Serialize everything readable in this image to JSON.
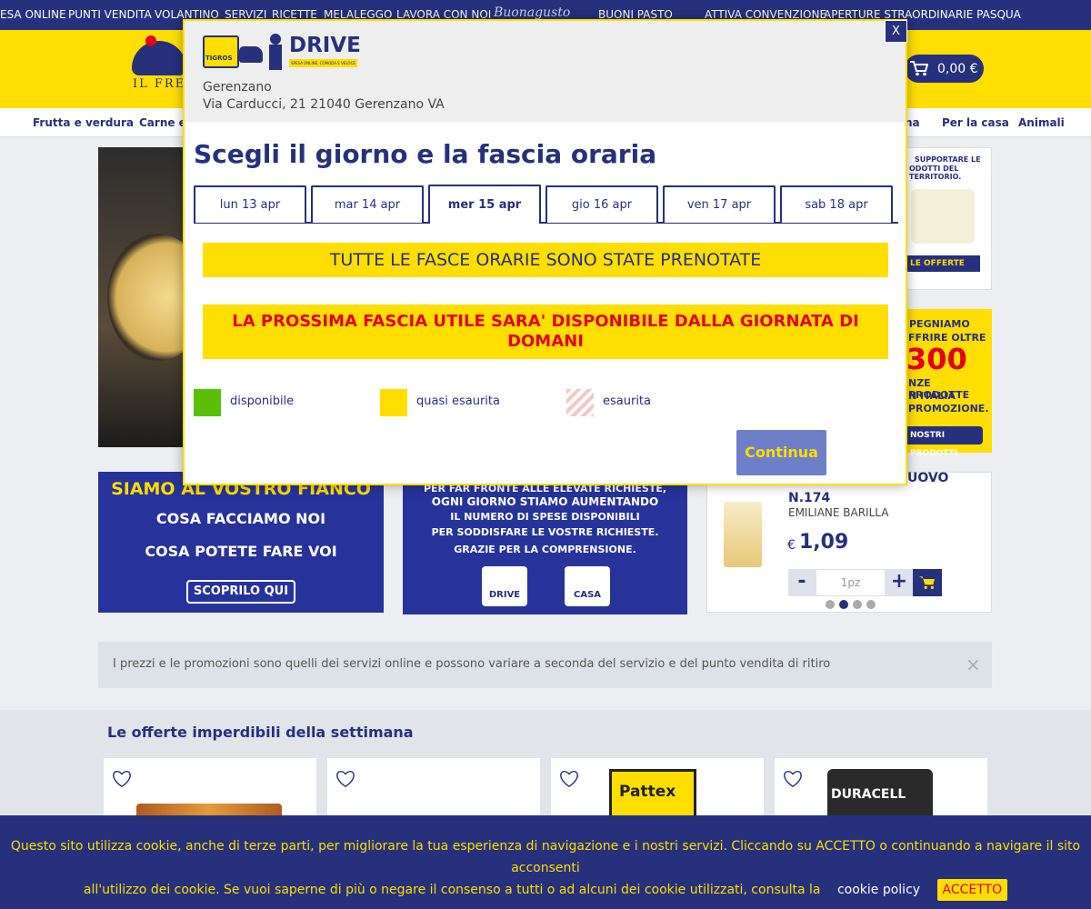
{
  "topbar": {
    "items": [
      "ESA ONLINE",
      "PUNTI VENDITA",
      "VOLANTINO",
      "SERVIZI",
      "RICETTE",
      "MELALEGGO",
      "LAVORA CON NOI",
      "Buonagusto",
      "BUONI PASTO",
      "ATTIVA CONVENZIONE",
      "APERTURE STRAORDINARIE PASQUA"
    ]
  },
  "header": {
    "logo_tagline": "IL FRES",
    "cart_total": "0,00 €"
  },
  "catnav": {
    "items": [
      "Frutta e verdura",
      "Carne e",
      "na",
      "Per la casa",
      "Animali"
    ]
  },
  "banners": {
    "rb1_line1": "SUPPORTARE LE",
    "rb1_line2": "ODOTTI DEL TERRITORIO.",
    "rb1_btn": "LE OFFERTE",
    "rb2_line1": "PEGNIAMO",
    "rb2_line2": "FFRIRE OLTRE",
    "rb2_num": "300",
    "rb2_line3": "NZE PRODOTTE",
    "rb2_line4": "N ITALIA",
    "rb2_line5": "PROMOZIONE.",
    "rb2_btn": "NOSTRI PRODOTTI",
    "siamo_title": "SIAMO AL VOSTRO FIANCO",
    "siamo_l1": "COSA FACCIAMO NOI",
    "siamo_l2": "COSA POTETE FARE VOI",
    "siamo_btn": "SCOPRILO QUI",
    "drive_l1": "PER FAR FRONTE ALLE ELEVATE RICHIESTE,",
    "drive_l2": "OGNI GIORNO STIAMO AUMENTANDO",
    "drive_l3": "IL NUMERO DI SPESE DISPONIBILI",
    "drive_l4": "PER SODDISFARE LE VOSTRE RICHIESTE.",
    "drive_l5": "GRAZIE PER LA COMPRENSIONE.",
    "drive_b1": "DRIVE",
    "drive_b2": "CASA"
  },
  "product": {
    "title_tail": "UOVO",
    "code": "N.174",
    "name": "EMILIANE BARILLA",
    "currency": "€",
    "price": "1,09",
    "qty": "1pz",
    "minus": "-",
    "plus": "+"
  },
  "notice": {
    "text": "I prezzi e le promozioni sono quelli dei servizi online e possono variare a seconda del servizio e del punto vendita di ritiro",
    "close": "×"
  },
  "offerte": {
    "title": "Le offerte imperdibili della settimana",
    "card3_brand": "Pattex",
    "card4_brand": "DURACELL"
  },
  "cookie": {
    "text1": "Questo sito utilizza cookie, anche di terze parti, per migliorare la tua esperienza di navigazione e i nostri servizi. Cliccando su ACCETTO o continuando a navigare il sito acconsenti",
    "text2": "all'utilizzo dei cookie. Se vuoi saperne di più o negare il consenso a tutti o ad alcuni dei cookie utilizzati, consulta la",
    "link": "cookie policy",
    "accept": "ACCETTO"
  },
  "modal": {
    "close": "X",
    "logo_brand": "TIGROS",
    "logo_service": "DRIVE",
    "logo_tagline": "SPESA ONLINE, COMODA E VELOCE",
    "store_name": "Gerenzano",
    "store_address": "Via Carducci, 21 21040 Gerenzano VA",
    "heading": "Scegli il giorno e la fascia oraria",
    "days": [
      "lun 13 apr",
      "mar 14 apr",
      "mer 15 apr",
      "gio 16 apr",
      "ven 17 apr",
      "sab 18 apr"
    ],
    "active_day_index": 2,
    "msg_booked": "TUTTE LE FASCE ORARIE SONO STATE PRENOTATE",
    "msg_next": "LA PROSSIMA FASCIA UTILE SARA' DISPONIBILE DALLA GIORNATA DI DOMANI",
    "legend": [
      {
        "label": "disponibile",
        "color": "#5bbf0a"
      },
      {
        "label": "quasi esaurita",
        "color": "#ffde00"
      },
      {
        "label": "esaurita",
        "color": "#f6c6c6"
      }
    ],
    "continue_label": "Continua"
  },
  "colors": {
    "navy": "#26307c",
    "yellow": "#ffde00",
    "red": "#e3001b"
  }
}
